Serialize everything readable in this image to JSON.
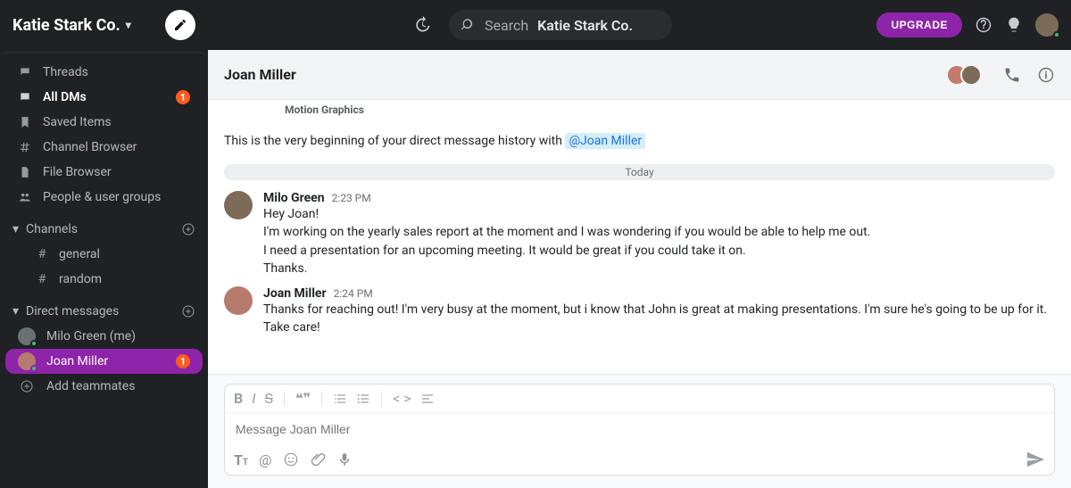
{
  "workspace": {
    "name": "Katie Stark Co."
  },
  "search": {
    "prefix": "Search",
    "placeholder": "Katie Stark Co."
  },
  "upgrade_label": "UPGRADE",
  "sidebar": {
    "items": [
      {
        "label": "Threads"
      },
      {
        "label": "All DMs",
        "badge": "1"
      },
      {
        "label": "Saved Items"
      },
      {
        "label": "Channel Browser"
      },
      {
        "label": "File Browser"
      },
      {
        "label": "People & user groups"
      }
    ],
    "channels_label": "Channels",
    "channels": [
      {
        "name": "general"
      },
      {
        "name": "random"
      }
    ],
    "dms_label": "Direct messages",
    "dms": [
      {
        "name": "Milo Green (me)",
        "badge": ""
      },
      {
        "name": "Joan Miller",
        "badge": "1"
      }
    ],
    "add_teammates": "Add teammates"
  },
  "conversation": {
    "title": "Joan Miller",
    "role": "Motion Graphics",
    "intro_prefix": "This is the very beginning of your direct message history with ",
    "intro_mention": "@Joan Miller",
    "divider": "Today",
    "messages": [
      {
        "author": "Milo Green",
        "time": "2:23 PM",
        "text": "Hey Joan!\nI'm working on the yearly sales report at the moment and I was wondering if you would be able to help me out.\nI need a presentation for an upcoming meeting. It would be great if you could take it on.\nThanks."
      },
      {
        "author": "Joan Miller",
        "time": "2:24 PM",
        "text": "Thanks for reaching out! I'm very busy at the moment, but i know that John is great at making presentations. I'm sure he's going to be up for it.\nTake care!"
      }
    ]
  },
  "composer": {
    "placeholder": "Message Joan Miller"
  }
}
